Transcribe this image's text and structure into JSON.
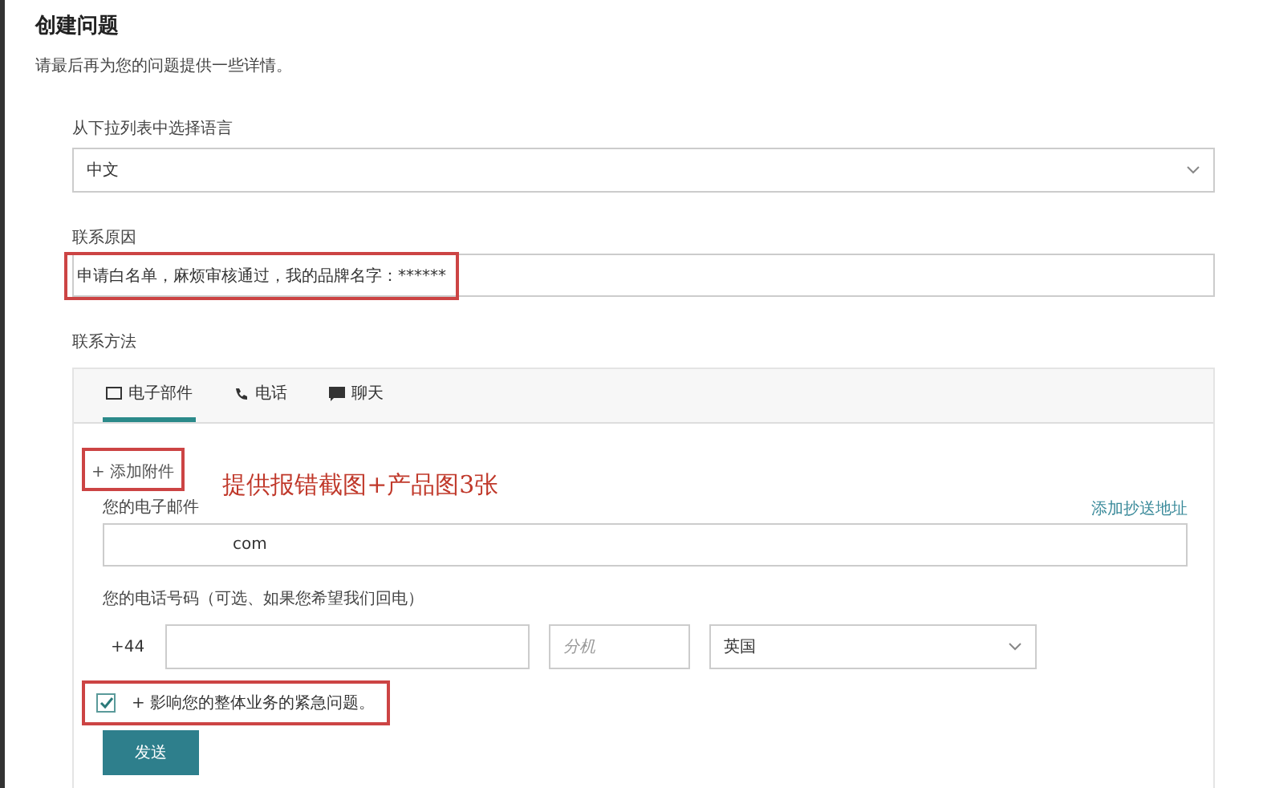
{
  "page": {
    "title": "创建问题",
    "subtitle": "请最后再为您的问题提供一些详情。"
  },
  "language": {
    "label": "从下拉列表中选择语言",
    "value": "中文"
  },
  "reason": {
    "label": "联系原因",
    "value": "申请白名单，麻烦审核通过，我的品牌名字：******",
    "highlighted": true
  },
  "contact": {
    "label": "联系方法",
    "tabs": [
      {
        "label": "电子部件",
        "kind": "mail",
        "selected": true
      },
      {
        "label": "电话",
        "kind": "phone",
        "selected": false
      },
      {
        "label": "聊天",
        "kind": "chat",
        "selected": false
      }
    ],
    "attach": {
      "label": "+ 添加附件",
      "highlighted": true
    },
    "note": "提供报错截图+产品图3张",
    "email": {
      "label": "您的电子邮件",
      "cc_link": "添加抄送地址",
      "value": "com"
    },
    "phone": {
      "label": "您的电话号码（可选、如果您希望我们回电）",
      "prefix": "+44",
      "extension_placeholder": "分机",
      "country": "英国"
    },
    "urgent": {
      "label": "+ 影响您的整体业务的紧急问题。",
      "checked": true,
      "highlighted": true
    },
    "submit": "发送"
  }
}
